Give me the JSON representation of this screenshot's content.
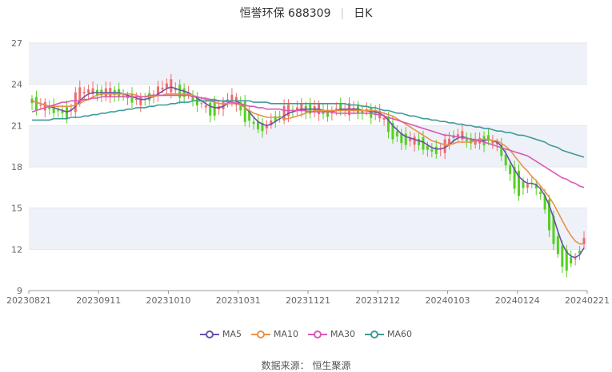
{
  "header": {
    "name": "恒誉环保 688309",
    "period": "日K"
  },
  "source": "数据来源： 恒生聚源",
  "colors": {
    "up": "#f06b6b",
    "down": "#53d11f",
    "grid_band": "#eef1f8"
  },
  "chart_data": {
    "type": "candlestick",
    "title": "恒誉环保 688309 日K",
    "x_ticks": [
      "20230821",
      "20230911",
      "20231010",
      "20231031",
      "20231121",
      "20231212",
      "20240103",
      "20240124",
      "20240221"
    ],
    "y_ticks": [
      9,
      12,
      15,
      18,
      21,
      24,
      27
    ],
    "ylim": [
      9,
      27
    ],
    "legend_position": "bottom",
    "legend": [
      {
        "name": "MA5",
        "color": "#6a52a8"
      },
      {
        "name": "MA10",
        "color": "#e8914a"
      },
      {
        "name": "MA30",
        "color": "#d95ab2"
      },
      {
        "name": "MA60",
        "color": "#3f9a9a"
      }
    ],
    "ohlc": [],
    "ma": {
      "MA5": [
        22.8,
        22.7,
        22.6,
        22.5,
        22.4,
        22.3,
        22.2,
        22.1,
        22.0,
        22.1,
        22.4,
        22.8,
        23.1,
        23.3,
        23.4,
        23.4,
        23.4,
        23.4,
        23.4,
        23.4,
        23.4,
        23.3,
        23.2,
        23.1,
        23.0,
        22.9,
        22.9,
        23.0,
        23.1,
        23.3,
        23.5,
        23.7,
        23.8,
        23.7,
        23.6,
        23.5,
        23.4,
        23.2,
        23.0,
        22.8,
        22.6,
        22.4,
        22.3,
        22.3,
        22.4,
        22.6,
        22.8,
        22.8,
        22.6,
        22.3,
        22.0,
        21.6,
        21.3,
        21.1,
        21.0,
        21.1,
        21.3,
        21.5,
        21.7,
        21.9,
        22.0,
        22.1,
        22.2,
        22.2,
        22.2,
        22.2,
        22.2,
        22.1,
        22.0,
        22.0,
        22.1,
        22.2,
        22.2,
        22.2,
        22.2,
        22.2,
        22.1,
        22.1,
        22.0,
        22.0,
        21.9,
        21.7,
        21.4,
        21.0,
        20.7,
        20.4,
        20.2,
        20.1,
        20.0,
        19.9,
        19.8,
        19.6,
        19.4,
        19.3,
        19.3,
        19.4,
        19.6,
        19.9,
        20.1,
        20.2,
        20.1,
        20.0,
        19.9,
        19.9,
        19.9,
        20.0,
        19.9,
        19.8,
        19.5,
        19.0,
        18.4,
        17.8,
        17.3,
        17.0,
        16.8,
        16.8,
        16.7,
        16.4,
        15.9,
        15.2,
        14.3,
        13.3,
        12.4,
        11.8,
        11.5,
        11.4,
        11.6,
        12.1
      ],
      "MA10": [
        22.8,
        22.7,
        22.6,
        22.5,
        22.4,
        22.4,
        22.4,
        22.4,
        22.4,
        22.4,
        22.5,
        22.6,
        22.8,
        22.9,
        23.1,
        23.2,
        23.3,
        23.3,
        23.3,
        23.3,
        23.3,
        23.3,
        23.3,
        23.3,
        23.2,
        23.1,
        23.1,
        23.1,
        23.1,
        23.2,
        23.2,
        23.3,
        23.3,
        23.3,
        23.3,
        23.3,
        23.3,
        23.2,
        23.1,
        23.0,
        22.9,
        22.8,
        22.7,
        22.6,
        22.6,
        22.6,
        22.6,
        22.6,
        22.5,
        22.3,
        22.1,
        21.9,
        21.8,
        21.7,
        21.6,
        21.6,
        21.6,
        21.6,
        21.5,
        21.5,
        21.6,
        21.7,
        21.8,
        21.9,
        22.0,
        22.1,
        22.1,
        22.1,
        22.1,
        22.1,
        22.1,
        22.1,
        22.1,
        22.1,
        22.1,
        22.1,
        22.1,
        22.1,
        22.1,
        22.1,
        22.0,
        21.9,
        21.8,
        21.7,
        21.5,
        21.3,
        21.1,
        20.9,
        20.7,
        20.5,
        20.3,
        20.1,
        19.9,
        19.8,
        19.7,
        19.6,
        19.6,
        19.7,
        19.8,
        19.8,
        19.8,
        19.8,
        19.9,
        20.0,
        20.0,
        20.0,
        19.9,
        19.9,
        19.7,
        19.5,
        19.2,
        18.8,
        18.4,
        18.0,
        17.7,
        17.3,
        17.0,
        16.6,
        16.2,
        15.8,
        15.3,
        14.7,
        14.1,
        13.5,
        13.0,
        12.6,
        12.4,
        12.4
      ],
      "MA30": [
        22.0,
        22.1,
        22.2,
        22.3,
        22.4,
        22.5,
        22.6,
        22.7,
        22.7,
        22.8,
        22.8,
        22.8,
        22.9,
        22.9,
        23.0,
        23.0,
        23.1,
        23.1,
        23.1,
        23.1,
        23.1,
        23.1,
        23.1,
        23.1,
        23.1,
        23.1,
        23.1,
        23.2,
        23.2,
        23.2,
        23.2,
        23.2,
        23.2,
        23.2,
        23.2,
        23.2,
        23.2,
        23.1,
        23.1,
        23.0,
        23.0,
        22.9,
        22.9,
        22.8,
        22.8,
        22.7,
        22.7,
        22.6,
        22.6,
        22.5,
        22.4,
        22.4,
        22.3,
        22.3,
        22.2,
        22.2,
        22.2,
        22.2,
        22.1,
        22.1,
        22.1,
        22.1,
        22.1,
        22.1,
        22.0,
        22.0,
        22.0,
        22.0,
        22.0,
        22.0,
        21.9,
        21.9,
        21.9,
        21.9,
        21.9,
        21.9,
        21.9,
        21.9,
        21.9,
        21.8,
        21.8,
        21.7,
        21.6,
        21.5,
        21.4,
        21.3,
        21.2,
        21.1,
        21.0,
        20.9,
        20.8,
        20.7,
        20.6,
        20.5,
        20.4,
        20.3,
        20.3,
        20.2,
        20.2,
        20.1,
        20.1,
        20.0,
        20.0,
        19.9,
        19.8,
        19.7,
        19.6,
        19.5,
        19.4,
        19.3,
        19.2,
        19.1,
        19.0,
        18.9,
        18.8,
        18.6,
        18.4,
        18.2,
        18.0,
        17.8,
        17.6,
        17.4,
        17.2,
        17.1,
        16.9,
        16.8,
        16.6,
        16.5
      ],
      "MA60": [
        21.4,
        21.4,
        21.4,
        21.4,
        21.4,
        21.5,
        21.5,
        21.5,
        21.5,
        21.6,
        21.6,
        21.6,
        21.7,
        21.7,
        21.8,
        21.8,
        21.9,
        21.9,
        22.0,
        22.0,
        22.1,
        22.1,
        22.2,
        22.2,
        22.3,
        22.3,
        22.3,
        22.4,
        22.4,
        22.5,
        22.5,
        22.5,
        22.6,
        22.6,
        22.7,
        22.7,
        22.7,
        22.8,
        22.8,
        22.8,
        22.8,
        22.8,
        22.8,
        22.8,
        22.8,
        22.8,
        22.8,
        22.8,
        22.8,
        22.8,
        22.8,
        22.7,
        22.7,
        22.7,
        22.7,
        22.6,
        22.6,
        22.6,
        22.6,
        22.6,
        22.6,
        22.6,
        22.6,
        22.6,
        22.6,
        22.6,
        22.6,
        22.6,
        22.6,
        22.6,
        22.6,
        22.6,
        22.6,
        22.5,
        22.5,
        22.5,
        22.4,
        22.4,
        22.3,
        22.3,
        22.2,
        22.1,
        22.1,
        22.0,
        21.9,
        21.9,
        21.8,
        21.7,
        21.7,
        21.6,
        21.5,
        21.5,
        21.4,
        21.4,
        21.3,
        21.3,
        21.2,
        21.2,
        21.1,
        21.1,
        21.0,
        21.0,
        20.9,
        20.9,
        20.8,
        20.8,
        20.7,
        20.6,
        20.6,
        20.5,
        20.5,
        20.4,
        20.3,
        20.3,
        20.2,
        20.1,
        20.0,
        19.9,
        19.8,
        19.6,
        19.5,
        19.4,
        19.2,
        19.1,
        19.0,
        18.9,
        18.8,
        18.7
      ]
    }
  }
}
